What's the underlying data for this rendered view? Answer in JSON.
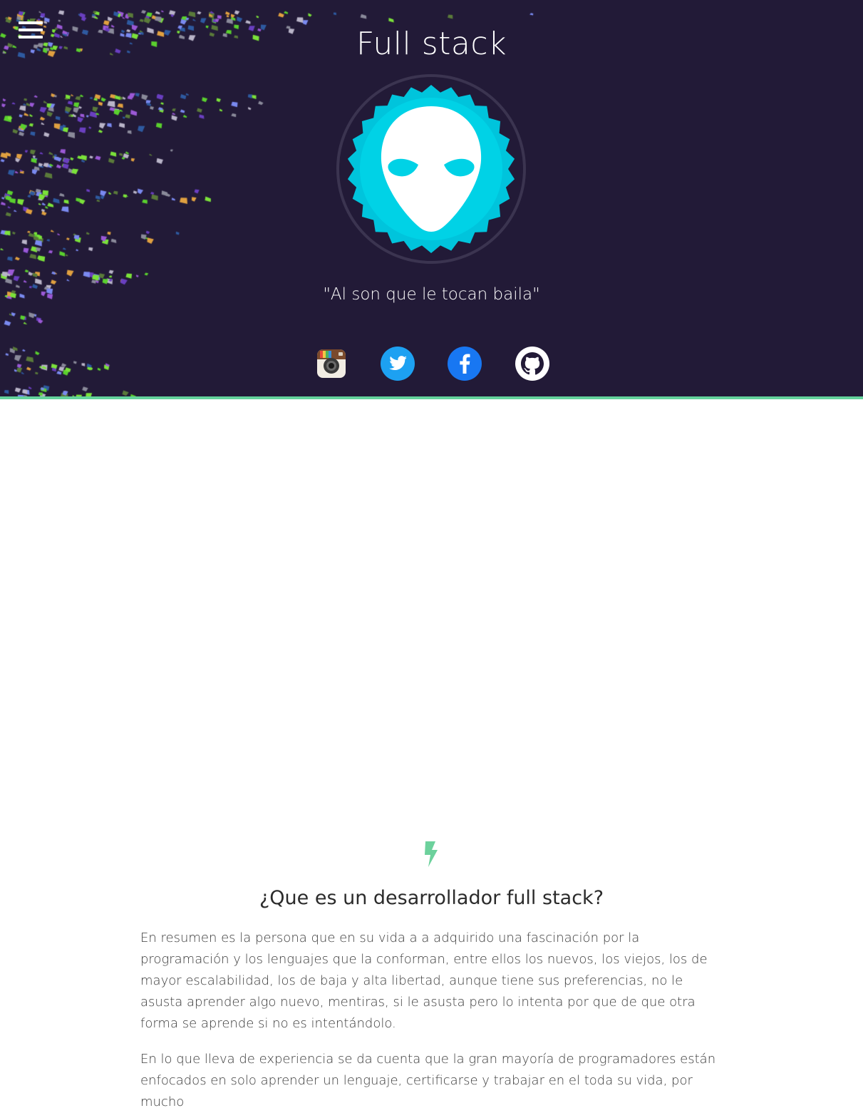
{
  "header": {
    "title": "Full stack",
    "quote": "\"Al son que le tocan baila\"",
    "menu_icon": "hamburger-menu-icon",
    "avatar_icon": "alien-icon",
    "background_color": "#221a37",
    "accent_border": "#64d39c"
  },
  "social": [
    {
      "name": "Instagram",
      "icon": "instagram-icon",
      "color": "#8a5a3c"
    },
    {
      "name": "Twitter",
      "icon": "twitter-icon",
      "color": "#1da1f2"
    },
    {
      "name": "Facebook",
      "icon": "facebook-icon",
      "color": "#1877f2"
    },
    {
      "name": "GitHub",
      "icon": "github-icon",
      "color": "#ffffff"
    }
  ],
  "section": {
    "icon": "lightning-bolt-icon",
    "title": "¿Que es un desarrollador full stack?",
    "paragraphs": [
      "En resumen es la persona que en su vida a a adquirido una fascinación por la programación y los lenguajes que la conforman, entre ellos los nuevos, los viejos, los de mayor escalabilidad, los de baja y alta libertad, aunque tiene sus preferencias, no le asusta aprender algo nuevo, mentiras, si le asusta pero lo intenta por que de que otra forma se aprende si no es intentándolo.",
      "En lo que lleva de experiencia se da cuenta que la gran mayoría de programadores están enfocados en solo aprender un lenguaje, certificarse y trabajar en el toda su vida, por mucho"
    ]
  }
}
